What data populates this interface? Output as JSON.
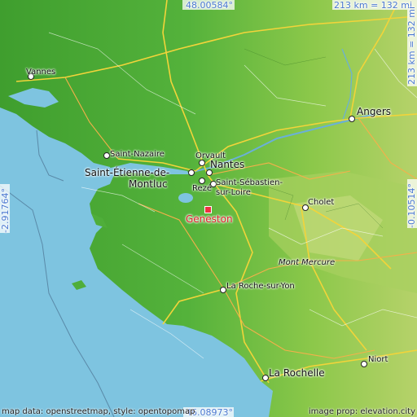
{
  "coords": {
    "top": "48.00584°",
    "bottom": "46.08973°",
    "left": "-2.91764°",
    "right": "-0.10514°"
  },
  "scale": {
    "top": "213 km = 132 mi",
    "right": "213 km = 132 mi"
  },
  "attribution": {
    "left": "map data: openstreetmap, style: opentopomap",
    "right": "image prop: elevation.city"
  },
  "places": {
    "vannes": "Vannes",
    "angers": "Angers",
    "saint_nazaire": "Saint-Nazaire",
    "orvault": "Orvault",
    "nantes": "Nantes",
    "saint_etienne_1": "Saint-Étienne-de-",
    "saint_etienne_2": "Montluc",
    "reze": "Rezé",
    "saint_sebastien_1": "Saint-Sébastien-",
    "saint_sebastien_2": "sur-Loire",
    "cholet": "Cholet",
    "geneston": "Geneston",
    "mont_mercure": "Mont Mercure",
    "la_roche": "La Roche-sur-Yon",
    "niort": "Niort",
    "la_rochelle": "La Rochelle"
  },
  "colors": {
    "water": "#7ec4e0",
    "land": "#4fae3a",
    "highlight": "#e0202a",
    "coord_text": "#4a78d0"
  }
}
